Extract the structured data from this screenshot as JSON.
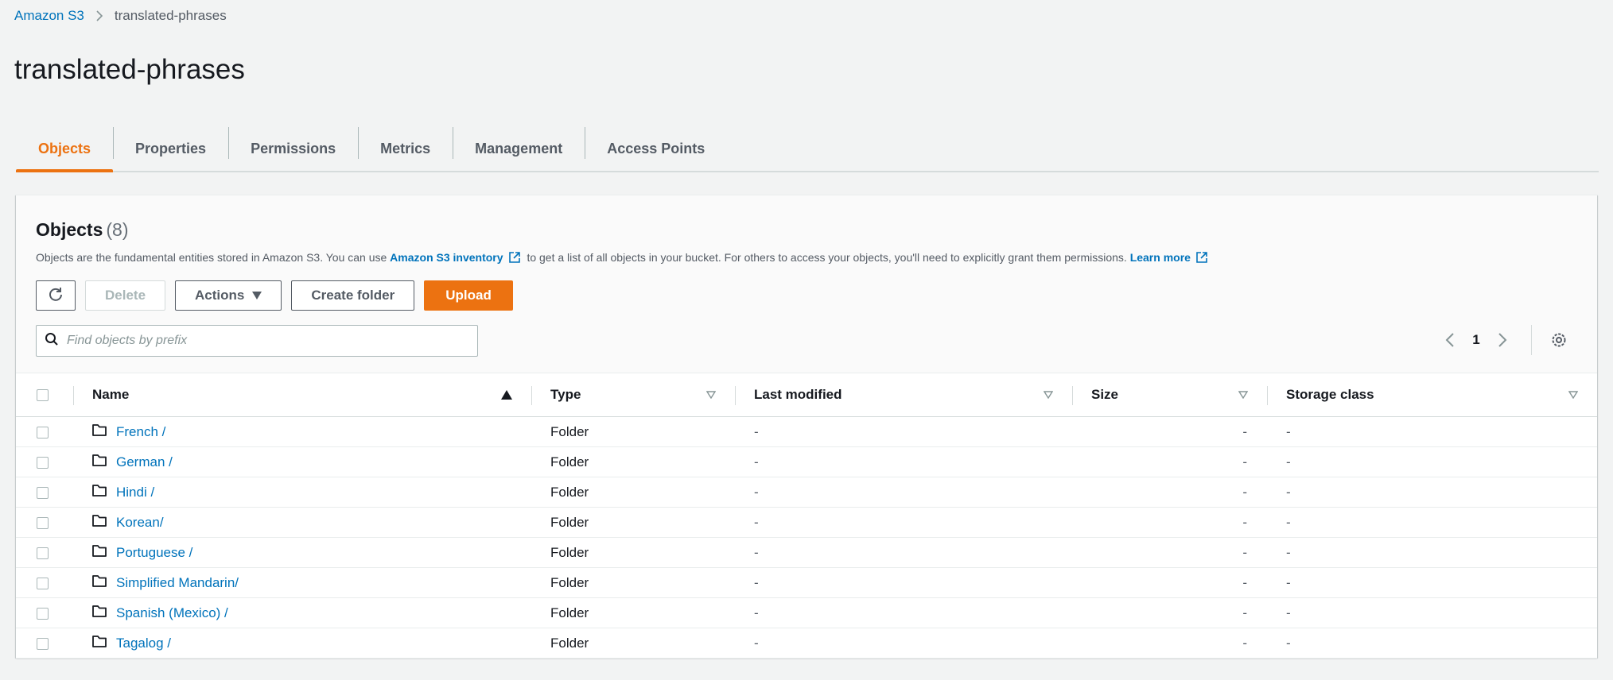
{
  "breadcrumb": {
    "root": "Amazon S3",
    "current": "translated-phrases"
  },
  "page_title": "translated-phrases",
  "tabs": [
    {
      "label": "Objects",
      "active": true
    },
    {
      "label": "Properties",
      "active": false
    },
    {
      "label": "Permissions",
      "active": false
    },
    {
      "label": "Metrics",
      "active": false
    },
    {
      "label": "Management",
      "active": false
    },
    {
      "label": "Access Points",
      "active": false
    }
  ],
  "objects_panel": {
    "heading": "Objects",
    "count": "(8)",
    "description": {
      "part1": "Objects are the fundamental entities stored in Amazon S3. You can use",
      "inventory_link": "Amazon S3 inventory",
      "part2": "to get a list of all objects in your bucket. For others to access your objects, you'll need to explicitly grant them permissions.",
      "learn_more": "Learn more"
    },
    "toolbar": {
      "refresh_icon": "refresh-icon",
      "delete_label": "Delete",
      "actions_label": "Actions",
      "create_folder_label": "Create folder",
      "upload_label": "Upload"
    },
    "search": {
      "placeholder": "Find objects by prefix",
      "value": ""
    },
    "pagination": {
      "current_page": "1"
    },
    "columns": [
      "Name",
      "Type",
      "Last modified",
      "Size",
      "Storage class"
    ],
    "rows": [
      {
        "name": "French /",
        "type": "Folder",
        "last_modified": "-",
        "size": "-",
        "storage_class": "-"
      },
      {
        "name": "German /",
        "type": "Folder",
        "last_modified": "-",
        "size": "-",
        "storage_class": "-"
      },
      {
        "name": "Hindi /",
        "type": "Folder",
        "last_modified": "-",
        "size": "-",
        "storage_class": "-"
      },
      {
        "name": "Korean/",
        "type": "Folder",
        "last_modified": "-",
        "size": "-",
        "storage_class": "-"
      },
      {
        "name": "Portuguese /",
        "type": "Folder",
        "last_modified": "-",
        "size": "-",
        "storage_class": "-"
      },
      {
        "name": "Simplified Mandarin/",
        "type": "Folder",
        "last_modified": "-",
        "size": "-",
        "storage_class": "-"
      },
      {
        "name": "Spanish (Mexico) /",
        "type": "Folder",
        "last_modified": "-",
        "size": "-",
        "storage_class": "-"
      },
      {
        "name": "Tagalog /",
        "type": "Folder",
        "last_modified": "-",
        "size": "-",
        "storage_class": "-"
      }
    ]
  },
  "colors": {
    "accent": "#ec7211",
    "link": "#0073bb",
    "background": "#f2f3f3"
  }
}
